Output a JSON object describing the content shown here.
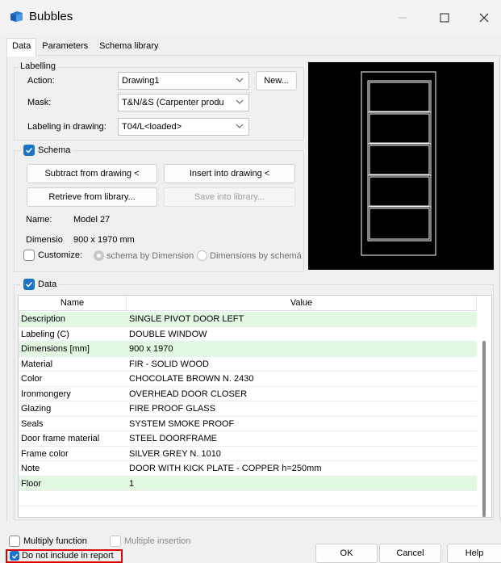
{
  "window": {
    "title": "Bubbles"
  },
  "tabs": [
    {
      "label": "Data"
    },
    {
      "label": "Parameters"
    },
    {
      "label": "Schema library"
    }
  ],
  "labelling": {
    "group_title": "Labelling",
    "action_label": "Action:",
    "action_value": "Drawing1",
    "new_button": "New...",
    "mask_label": "Mask:",
    "mask_value": "T&N/&S (Carpenter produ",
    "labeling_label": "Labeling in drawing:",
    "labeling_value": "T04/L<loaded>"
  },
  "schema": {
    "group_title": "Schema",
    "checked": true,
    "subtract_button": "Subtract from drawing <",
    "insert_button": "Insert into drawing <",
    "retrieve_button": "Retrieve from library...",
    "save_button": "Save into library...",
    "name_label": "Name:",
    "name_value": "Model 27",
    "dimension_label": "Dimensio",
    "dimension_value": "900 x 1970 mm",
    "customize_label": "Customize:",
    "radio1_label": "schema by Dimension",
    "radio2_label": "Dimensions by schemá"
  },
  "data": {
    "group_title": "Data",
    "checked": true,
    "columns": [
      "Name",
      "Value"
    ],
    "rows": [
      {
        "name": "Description",
        "value": "SINGLE PIVOT DOOR LEFT",
        "highlight": true
      },
      {
        "name": "Labeling (C)",
        "value": "DOUBLE WINDOW",
        "highlight": false
      },
      {
        "name": "Dimensions [mm]",
        "value": "900 x 1970",
        "highlight": true
      },
      {
        "name": "Material",
        "value": "FIR - SOLID WOOD",
        "highlight": false
      },
      {
        "name": "Color",
        "value": "CHOCOLATE BROWN N. 2430",
        "highlight": false
      },
      {
        "name": "Ironmongery",
        "value": "OVERHEAD DOOR CLOSER",
        "highlight": false
      },
      {
        "name": "Glazing",
        "value": "FIRE PROOF GLASS",
        "highlight": false
      },
      {
        "name": "Seals",
        "value": "SYSTEM SMOKE PROOF",
        "highlight": false
      },
      {
        "name": "Door frame material",
        "value": "STEEL DOORFRAME",
        "highlight": false
      },
      {
        "name": "Frame color",
        "value": "SILVER GREY N. 1010",
        "highlight": false
      },
      {
        "name": "Note",
        "value": "DOOR WITH KICK PLATE - COPPER h=250mm",
        "highlight": false
      },
      {
        "name": "Floor",
        "value": "1",
        "highlight": true
      }
    ]
  },
  "footer": {
    "multiply_label": "Multiply function",
    "multiple_insertion_label": "Multiple insertion",
    "not_include_label": "Do not include in report",
    "ok_button": "OK",
    "cancel_button": "Cancel",
    "help_button": "Help"
  },
  "colors": {
    "accent": "#1a73c9",
    "highlight_row": "#e3f8e3",
    "focus_outline": "#e00000"
  }
}
